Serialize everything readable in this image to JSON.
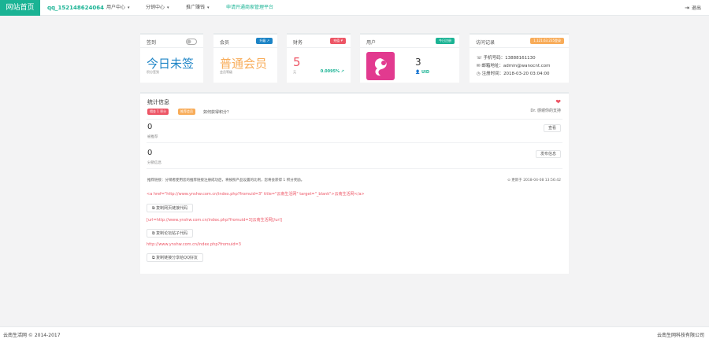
{
  "colors": {
    "accent": "#1ab394",
    "primary": "#1c84c6",
    "danger": "#ed5565",
    "warning": "#f8ac59",
    "pink": "#e23a8f"
  },
  "nav": {
    "home": "网站首页",
    "qq": "qq_152148624064",
    "items": [
      "用户中心",
      "分销中心",
      "推广赚钱"
    ],
    "partner": "申请开通商家管理平台",
    "logout": "退出",
    "logout_icon": "sign-out-icon"
  },
  "cards": {
    "checkin": {
      "title": "签到",
      "value": "今日未签",
      "sub": "积分签到",
      "icon": "toggle-icon"
    },
    "member": {
      "title": "会员",
      "badge": "升级 ↗",
      "value": "普通会员",
      "sub": "会员等级"
    },
    "finance": {
      "title": "财务",
      "badge": "充值 ¥",
      "value": "5",
      "sub": "元",
      "rate": "0.0095% ↗"
    },
    "users": {
      "title": "用户",
      "badge": "今日注册",
      "value": "3",
      "sub": "UID",
      "avatar_icon": "pink-avatar-logo"
    },
    "access": {
      "title": "访问记录",
      "badge": "1.121.63.235登录",
      "phone": "手机号码：13888161130",
      "email": "邮箱地址：admin@wanocnt.com",
      "time": "注册时间：2018-03-20 03:04:00"
    }
  },
  "stats": {
    "title": "统计信息",
    "tags": [
      "佣金 1 积分",
      "推荐会员"
    ],
    "help": "如何获得积分？",
    "heart_icon": "heart-icon",
    "thanks": "Dr. 感谢你的支持",
    "count1": "0",
    "count1_label": "被推荐",
    "view_btn": "查看",
    "count2": "0",
    "count2_label": "分销信息",
    "publish_btn": "发布信息",
    "notice": "推荐链接：分销者使用您的推荐链接注册成功后，将按照产品设置的比例，您将会获得 1 积分奖励。",
    "updated": "⊙ 更新于 2018-04-08 13:56:42",
    "html_code": "<a href=\"http://www.ynshw.com.cn/index.php?fromuid=3\" title=\"云南生活网\" target=\"_blank\">云南生活网</a>",
    "copy_html": "复制网页链接代码",
    "ubb_code": "[url=http://www.ynshw.com.cn/index.php?fromuid=3]云南生活网[/url]",
    "copy_ubb": "复制论坛帖子代码",
    "url_code": "http://www.ynshw.com.cn/index.php?fromuid=3",
    "copy_qq": "复制链接分享给QQ好友"
  },
  "footer": {
    "left": "云南生活网 © 2014-2017",
    "right": "云南生网科技有限公司"
  }
}
